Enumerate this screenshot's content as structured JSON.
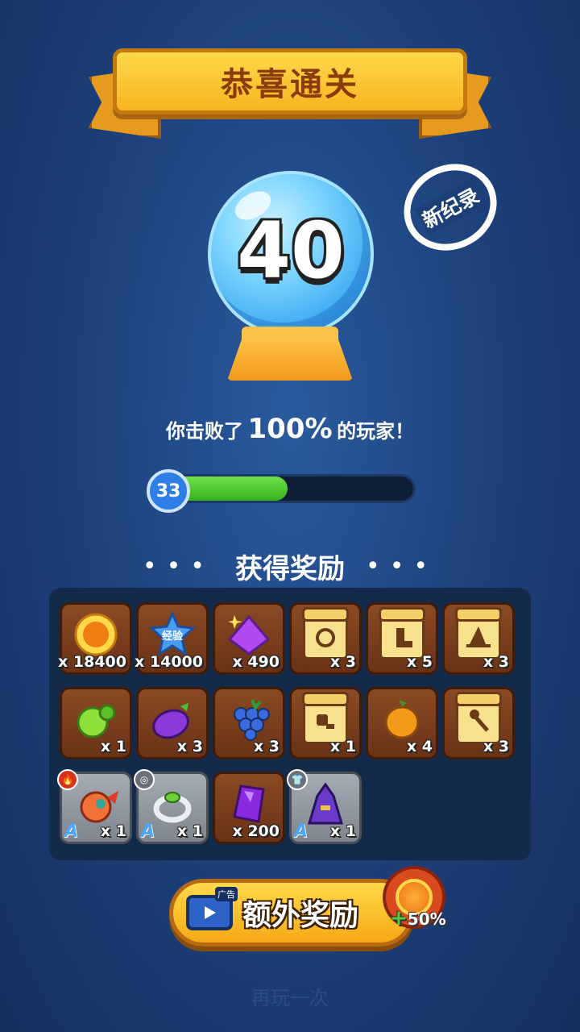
{
  "banner": {
    "title": "恭喜通关"
  },
  "score": {
    "value": "40"
  },
  "stamp": {
    "label": "新纪录"
  },
  "defeat": {
    "prefix": "你击败了",
    "percent": "100%",
    "suffix": "的玩家！"
  },
  "level": {
    "value": "33",
    "progress": 0.5
  },
  "rewards": {
    "title": "获得奖励",
    "items": [
      {
        "name": "gold-coin",
        "count": "x 18400"
      },
      {
        "name": "exp-star",
        "label": "经验",
        "count": "x 14000"
      },
      {
        "name": "purple-gem",
        "count": "x 490"
      },
      {
        "name": "scroll-ring",
        "count": "x 3"
      },
      {
        "name": "scroll-boot",
        "count": "x 5"
      },
      {
        "name": "scroll-hat",
        "count": "x 3"
      },
      {
        "name": "green-fruit",
        "count": "x 1"
      },
      {
        "name": "eggplant",
        "count": "x 3"
      },
      {
        "name": "grapes",
        "count": "x 3"
      },
      {
        "name": "scroll-meat",
        "count": "x 1"
      },
      {
        "name": "orange-fruit",
        "count": "x 4"
      },
      {
        "name": "scroll-staff",
        "count": "x 3"
      },
      {
        "name": "dragon-pet",
        "grade": "A",
        "count": "x 1"
      },
      {
        "name": "silver-ring",
        "grade": "A",
        "count": "x 1"
      },
      {
        "name": "purple-crystal",
        "count": "x 200"
      },
      {
        "name": "purple-robe",
        "grade": "A",
        "count": "x 1"
      }
    ]
  },
  "extra": {
    "label": "额外奖励",
    "tv_tag": "广告",
    "bonus": "50%",
    "bonus_plus": "+"
  },
  "ghost_text": "再玩一次",
  "colors": {
    "accent": "#f6b521",
    "progress": "#37b21d",
    "background": "#1c3f78"
  }
}
